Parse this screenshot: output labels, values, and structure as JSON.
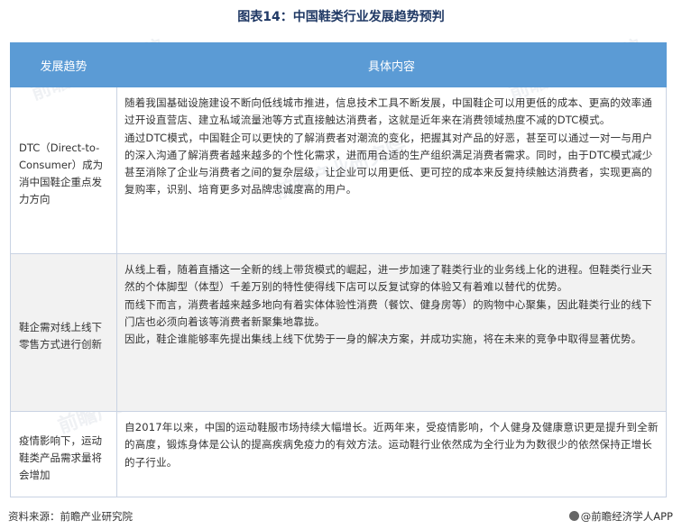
{
  "title": "图表14：中国鞋类行业发展趋势预判",
  "header": {
    "col1": "发展趋势",
    "col2": "具体内容"
  },
  "rows": [
    {
      "trend": "DTC（Direct-to-Consumer）成为消中国鞋企重点发力方向",
      "paragraphs": [
        "随着我国基础设施建设不断向低线城市推进，信息技术工具不断发展，中国鞋企可以用更低的成本、更高的效率通过开设直营店、建立私域流量池等方式直接触达消费者，这就是近年来在消费领域热度不减的DTC模式。",
        "通过DTC模式，中国鞋企可以更快的了解消费者对潮流的变化，把握其对产品的好恶，甚至可以通过一对一与用户的深入沟通了解消费者越来越多的个性化需求，进而用合适的生产组织满足消费者需求。同时，由于DTC模式减少甚至消除了企业与消费者之间的复杂层级，让企业可以用更低、更可控的成本来反复持续触达消费者，实现更高的复购率，识别、培育更多对品牌忠诚度高的用户。"
      ]
    },
    {
      "trend": "鞋企需对线上线下零售方式进行创新",
      "paragraphs": [
        "从线上看，随着直播这一全新的线上带货模式的崛起，进一步加速了鞋类行业的业务线上化的进程。但鞋类行业天然的个体脚型（体型）千差万别的特性使得线下店可以反复试穿的体验又有着难以替代的优势。",
        "而线下而言，消费者越来越多地向有着实体体验性消费（餐饮、健身房等）的购物中心聚集，因此鞋类行业的线下门店也必须向着该等消费者新聚集地靠拢。",
        "因此，鞋企谁能够率先提出集线上线下优势于一身的解决方案，并成功实施，将在未来的竞争中取得显著优势。"
      ]
    },
    {
      "trend": "疫情影响下，运动鞋类产品需求量将会增加",
      "paragraphs": [
        "自2017年以来，中国的运动鞋服市场持续大幅增长。近两年来，受疫情影响，个人健身及健康意识更是提升到全新的高度，锻炼身体是公认的提高疾病免疫力的有效方法。运动鞋行业依然成为全行业为为数很少的依然保持正增长的子行业。"
      ]
    }
  ],
  "footer": {
    "source": "资料来源：前瞻产业研究院",
    "brand": "@前瞻经济学人APP"
  },
  "watermark": "前瞻产业研究院",
  "colors": {
    "header_bg": "#5b9bd5",
    "title": "#1f3864",
    "row_alt": "#f2f2f2"
  }
}
